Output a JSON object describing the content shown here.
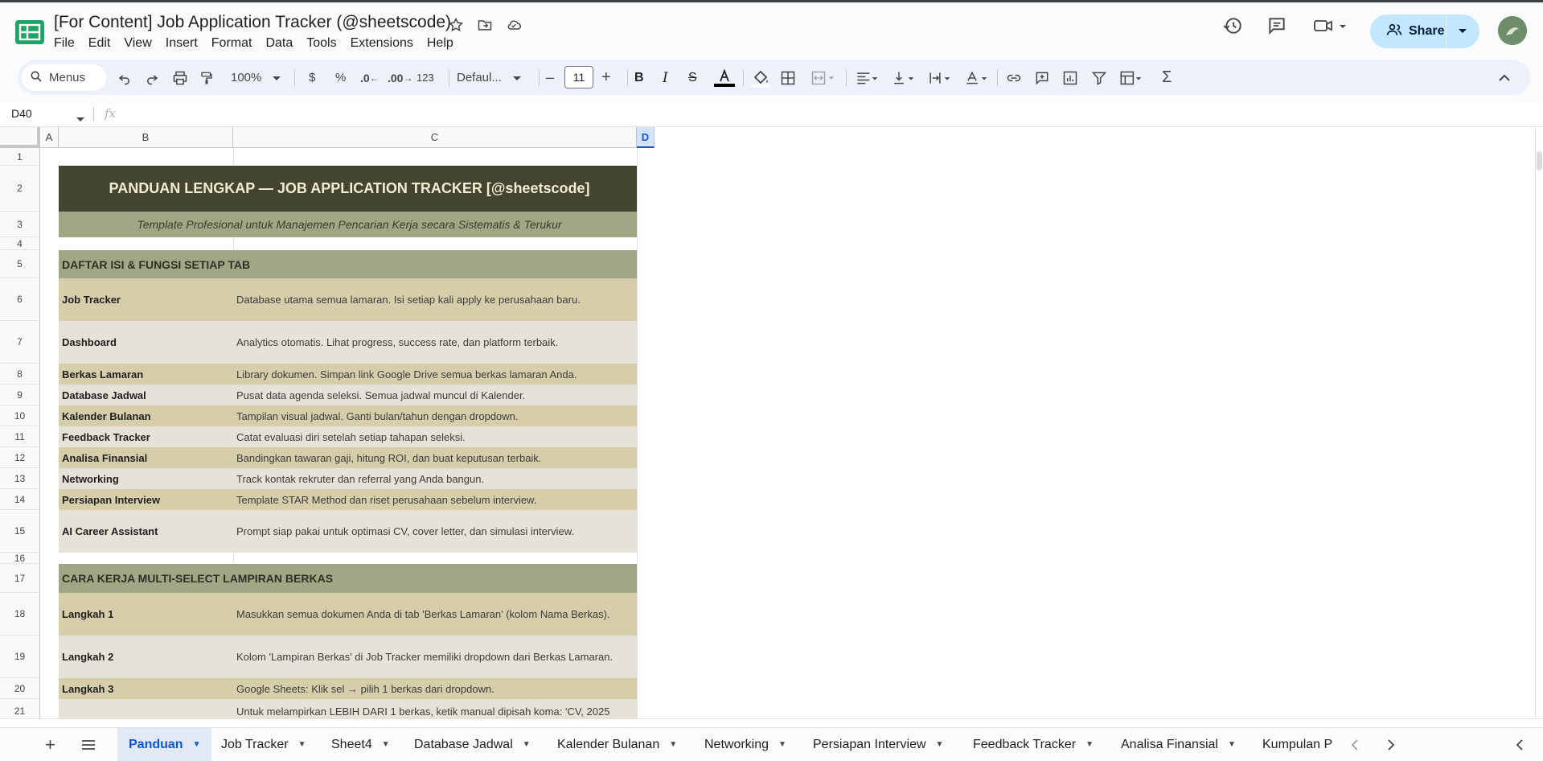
{
  "app": {
    "doc_title": "[For Content] Job Application Tracker (@sheetscode)",
    "menu": [
      "File",
      "Edit",
      "View",
      "Insert",
      "Format",
      "Data",
      "Tools",
      "Extensions",
      "Help"
    ],
    "share_label": "Share"
  },
  "toolbar": {
    "search_label": "Menus",
    "zoom": "100%",
    "currency": "$",
    "percent": "%",
    "dec_decrease": ".0",
    "dec_increase": ".00",
    "number_format": "123",
    "font": "Defaul...",
    "font_size": "11"
  },
  "formula_bar": {
    "name_box": "D40",
    "fx": "fx",
    "value": ""
  },
  "columns": [
    "A",
    "B",
    "C",
    "D"
  ],
  "rows": [
    "1",
    "2",
    "3",
    "4",
    "5",
    "6",
    "7",
    "8",
    "9",
    "10",
    "11",
    "12",
    "13",
    "14",
    "15",
    "16",
    "17",
    "18",
    "19",
    "20",
    "21"
  ],
  "sheet": {
    "title": "PANDUAN LENGKAP — JOB APPLICATION TRACKER [@sheetscode]",
    "subtitle": "Template Profesional untuk Manajemen Pencarian Kerja secara Sistematis & Terukur",
    "section1": "DAFTAR ISI & FUNGSI SETIAP TAB",
    "tabs_info": [
      {
        "name": "Job Tracker",
        "desc": "Database utama semua lamaran. Isi setiap kali apply ke perusahaan baru."
      },
      {
        "name": "Dashboard",
        "desc": "Analytics otomatis. Lihat progress, success rate, dan platform terbaik."
      },
      {
        "name": "Berkas Lamaran",
        "desc": "Library dokumen. Simpan link Google Drive semua berkas lamaran Anda."
      },
      {
        "name": "Database Jadwal",
        "desc": "Pusat data agenda seleksi. Semua jadwal muncul di Kalender."
      },
      {
        "name": "Kalender Bulanan",
        "desc": "Tampilan visual jadwal. Ganti bulan/tahun dengan dropdown."
      },
      {
        "name": "Feedback Tracker",
        "desc": "Catat evaluasi diri setelah setiap tahapan seleksi."
      },
      {
        "name": "Analisa Finansial",
        "desc": "Bandingkan tawaran gaji, hitung ROI, dan buat keputusan terbaik."
      },
      {
        "name": "Networking",
        "desc": "Track kontak rekruter dan referral yang Anda bangun."
      },
      {
        "name": "Persiapan Interview",
        "desc": "Template STAR Method dan riset perusahaan sebelum interview."
      },
      {
        "name": "AI Career Assistant",
        "desc": "Prompt siap pakai untuk optimasi CV, cover letter, dan simulasi interview."
      }
    ],
    "section2": "CARA KERJA MULTI-SELECT LAMPIRAN BERKAS",
    "steps": [
      {
        "name": "Langkah 1",
        "desc": "Masukkan semua dokumen Anda di tab 'Berkas Lamaran' (kolom Nama Berkas)."
      },
      {
        "name": "Langkah 2",
        "desc": "Kolom 'Lampiran Berkas' di Job Tracker memiliki dropdown dari Berkas Lamaran."
      },
      {
        "name": "Langkah 3",
        "desc": "Google Sheets: Klik sel → pilih 1 berkas dari dropdown."
      },
      {
        "name": "",
        "desc": "Untuk melampirkan LEBIH DARI 1 berkas, ketik manual dipisah koma: 'CV, 2025"
      }
    ]
  },
  "sheet_tabs": [
    "Panduan",
    "Job Tracker",
    "Sheet4",
    "Database Jadwal",
    "Kalender Bulanan",
    "Networking",
    "Persiapan Interview",
    "Feedback Tracker",
    "Analisa Finansial",
    "Kumpulan P"
  ],
  "colors": {
    "title_bg": "#434530",
    "title_text": "#f3ecd2",
    "subtitle_bg": "#9fa784",
    "section_bg": "#9fa784",
    "row_odd": "#d6ceaa",
    "row_even": "#e6e2d8",
    "accent": "#0b57d0"
  }
}
